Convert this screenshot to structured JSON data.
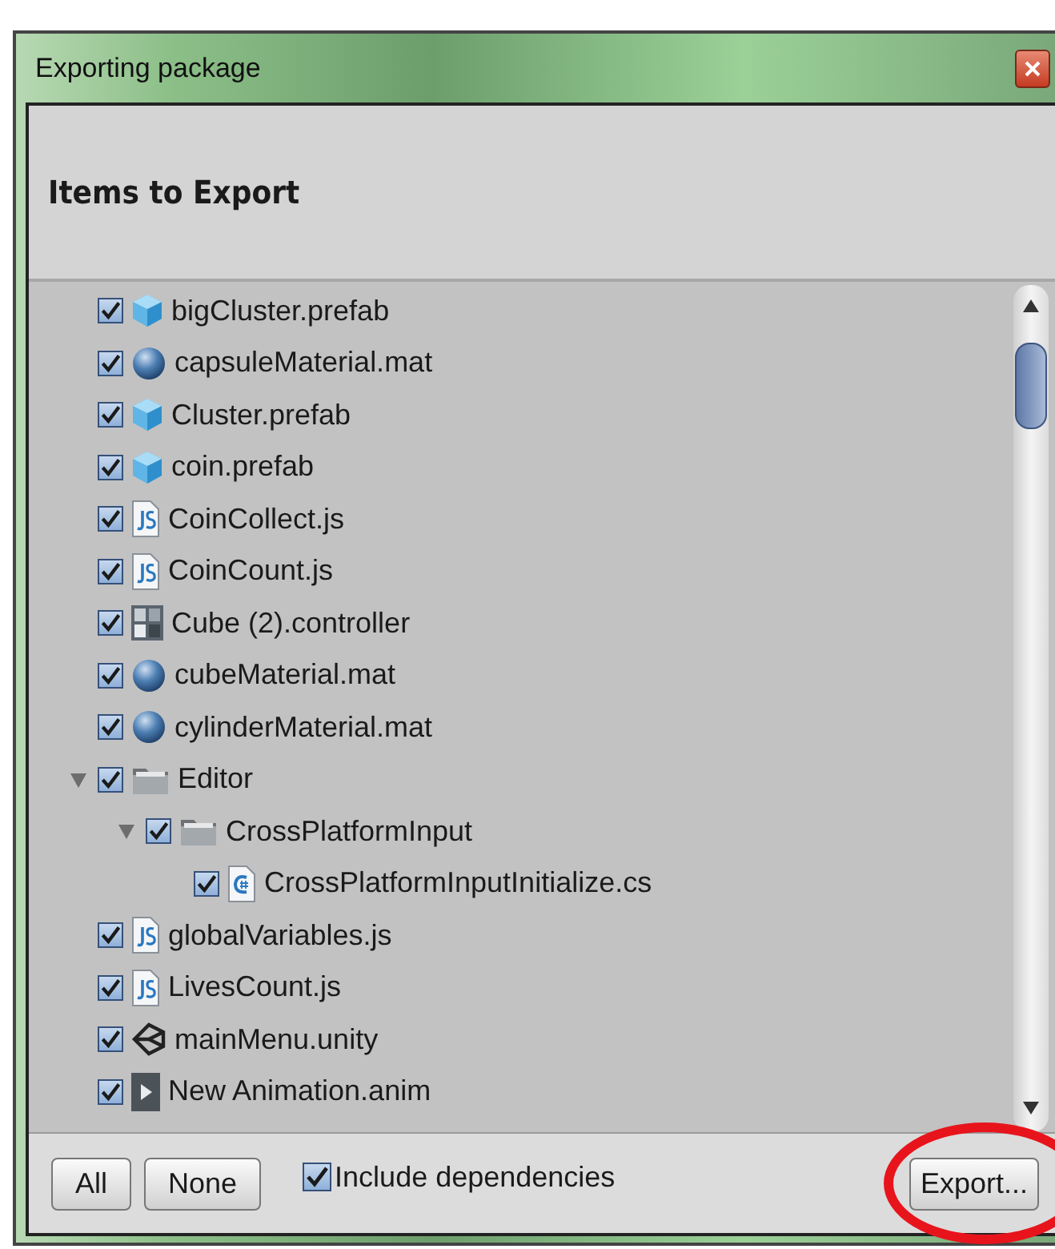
{
  "window": {
    "title": "Exporting package"
  },
  "header": "Items to Export",
  "items": [
    {
      "label": "bigCluster.prefab",
      "kind": "prefab",
      "checked": true
    },
    {
      "label": "capsuleMaterial.mat",
      "kind": "material",
      "checked": true
    },
    {
      "label": "Cluster.prefab",
      "kind": "prefab",
      "checked": true
    },
    {
      "label": "coin.prefab",
      "kind": "prefab",
      "checked": true
    },
    {
      "label": "CoinCollect.js",
      "kind": "js",
      "checked": true
    },
    {
      "label": "CoinCount.js",
      "kind": "js",
      "checked": true
    },
    {
      "label": "Cube (2).controller",
      "kind": "controller",
      "checked": true
    },
    {
      "label": "cubeMaterial.mat",
      "kind": "material",
      "checked": true
    },
    {
      "label": "cylinderMaterial.mat",
      "kind": "material",
      "checked": true
    },
    {
      "label": "Editor",
      "kind": "folder",
      "checked": true,
      "expanded": true,
      "children": [
        {
          "label": "CrossPlatformInput",
          "kind": "folder",
          "checked": true,
          "expanded": true,
          "children": [
            {
              "label": "CrossPlatformInputInitialize.cs",
              "kind": "cs",
              "checked": true
            }
          ]
        }
      ]
    },
    {
      "label": "globalVariables.js",
      "kind": "js",
      "checked": true
    },
    {
      "label": "LivesCount.js",
      "kind": "js",
      "checked": true
    },
    {
      "label": "mainMenu.unity",
      "kind": "unity",
      "checked": true
    },
    {
      "label": "New Animation.anim",
      "kind": "anim",
      "checked": true
    }
  ],
  "footer": {
    "buttons": [
      "All",
      "None"
    ],
    "include_dependencies": {
      "label": "Include dependencies",
      "checked": true
    },
    "export_button": "Export...",
    "export_highlight": {
      "color": "#e8141c"
    }
  }
}
